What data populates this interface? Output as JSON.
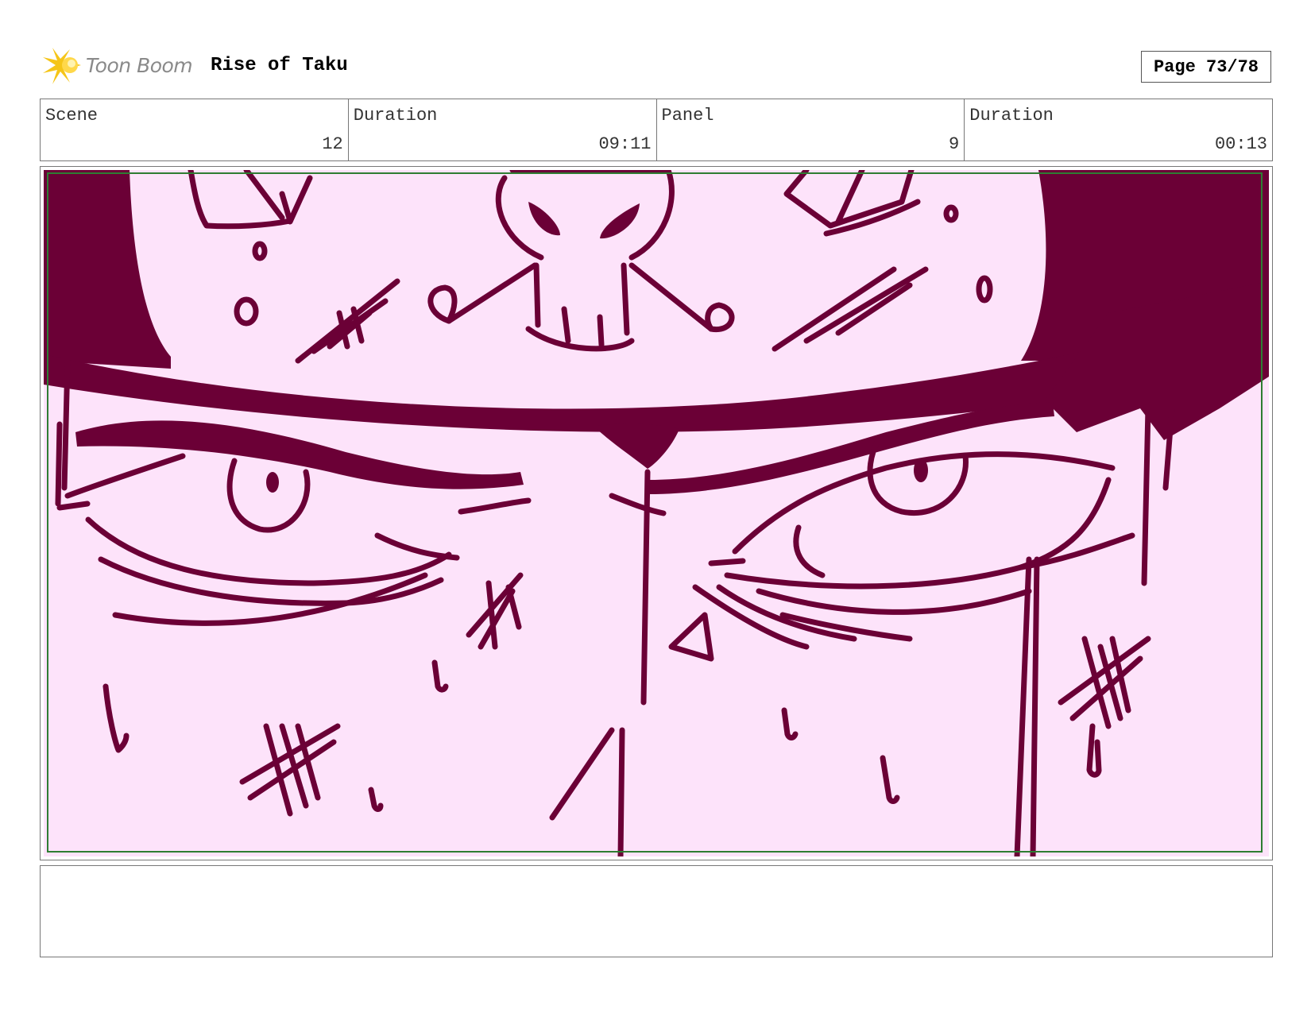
{
  "header": {
    "logo_text": "Toon Boom",
    "project_title": "Rise of Taku",
    "page_label": "Page 73/78"
  },
  "info": {
    "scene_label": "Scene",
    "scene_value": "12",
    "scene_duration_label": "Duration",
    "scene_duration_value": "09:11",
    "panel_label": "Panel",
    "panel_value": "9",
    "panel_duration_label": "Duration",
    "panel_duration_value": "00:13"
  },
  "notes": {
    "text": ""
  },
  "colors": {
    "ink": "#6b0036",
    "panel_background": "#fde3fa",
    "safe_frame": "#2e7d32",
    "logo_star": "#f5c518"
  }
}
